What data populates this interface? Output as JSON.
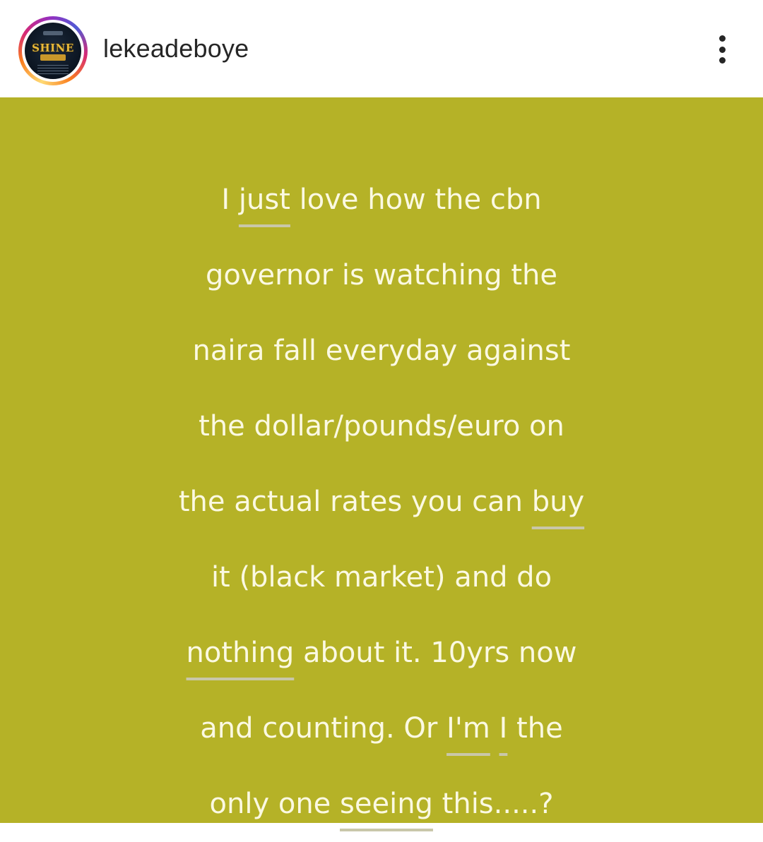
{
  "header": {
    "username": "lekeadeboye",
    "avatar_text": "SHINE",
    "more_icon": "more-vertical-icon"
  },
  "post": {
    "background_color": "#b5b227",
    "text_color": "#fbf9e2",
    "lines": [
      [
        "I ",
        "just",
        " love how the cbn"
      ],
      [
        "governor is watching the"
      ],
      [
        "naira fall everyday against"
      ],
      [
        "the dollar/pounds/euro on"
      ],
      [
        "the actual rates you can ",
        "buy"
      ],
      [
        "it (black market) and do"
      ],
      [
        "nothing",
        " about it. 10yrs now"
      ],
      [
        "and counting. Or ",
        "I'm",
        " ",
        "I",
        " the"
      ],
      [
        "only one ",
        "seeing",
        " this.....?"
      ]
    ]
  }
}
